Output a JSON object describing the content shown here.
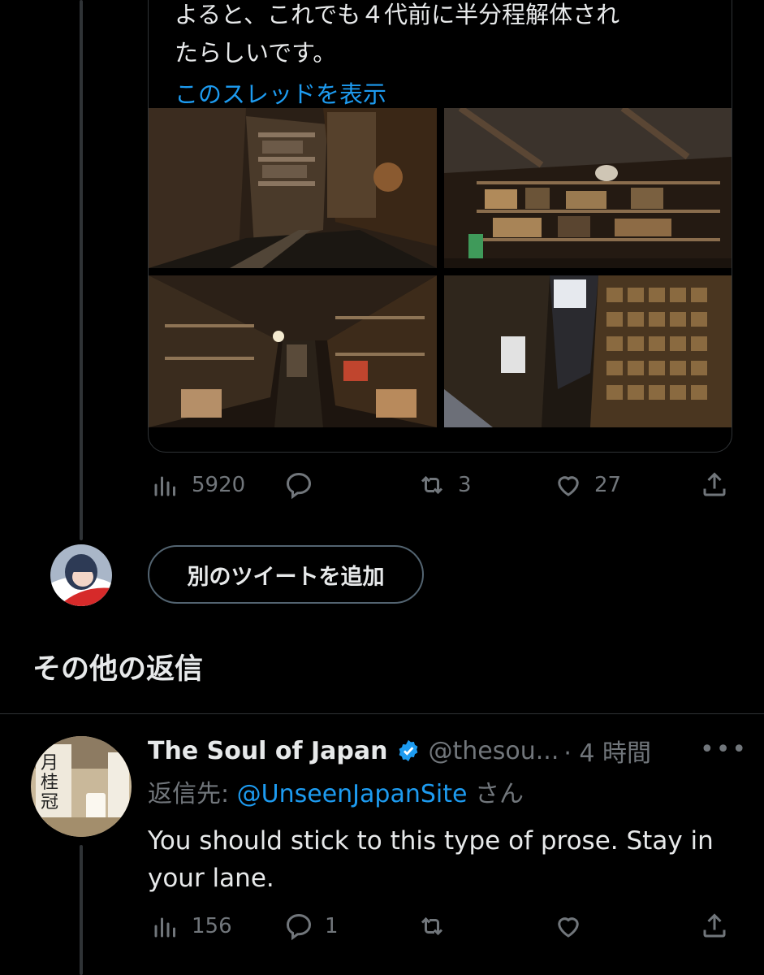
{
  "quoted_tweet": {
    "text": "よると、これでも４代前に半分程解体され\nたらしいです。",
    "thread_link": "このスレッドを表示",
    "photos": [
      "warehouse-aisle-photo",
      "storage-shelves-photo",
      "lit-corridor-photo",
      "tiled-wall-photo"
    ]
  },
  "tweet_actions": {
    "views": "5920",
    "replies": "",
    "retweets": "3",
    "likes": "27"
  },
  "add_tweet_button": "別のツイートを追加",
  "section_title": "その他の返信",
  "reply": {
    "name": "The Soul of Japan",
    "verified": true,
    "handle": "@thesou...",
    "time": "· 4 時間",
    "replying_prefix": "返信先: ",
    "replying_to": "@UnseenJapanSite",
    "replying_suffix": " さん",
    "body": "You should stick to this type of prose.  Stay in your lane.",
    "more": "•••",
    "views": "156",
    "replies": "1",
    "retweets": "",
    "likes": ""
  },
  "colors": {
    "accent": "#1d9bf0",
    "muted": "#71767b",
    "border": "#2f3336"
  }
}
